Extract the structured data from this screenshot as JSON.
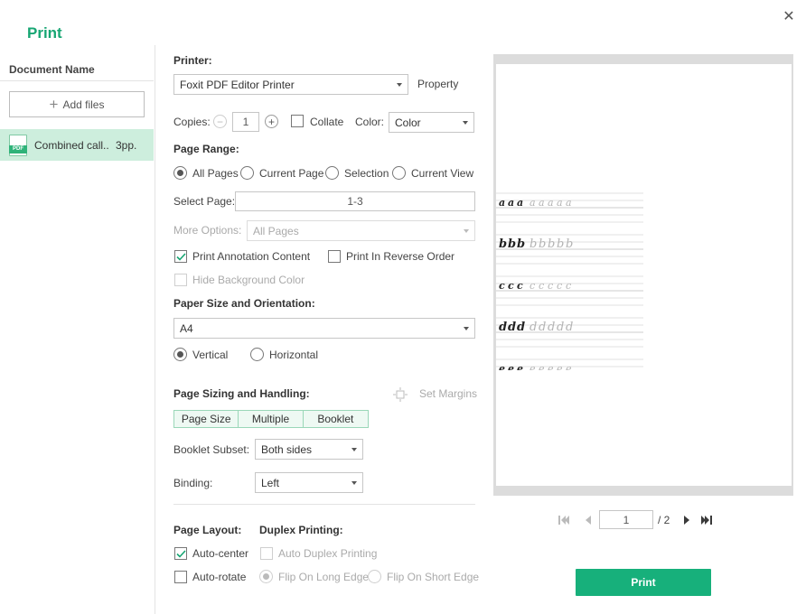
{
  "dialog": {
    "title": "Print"
  },
  "left": {
    "header": "Document Name",
    "add_files": "Add files",
    "documents": [
      {
        "name": "Combined call..",
        "pages": "3pp."
      }
    ]
  },
  "printer": {
    "label": "Printer:",
    "selected": "Foxit PDF Editor Printer",
    "property": "Property"
  },
  "copies": {
    "label": "Copies:",
    "value": "1",
    "collate_label": "Collate",
    "collate_checked": false
  },
  "color": {
    "label": "Color:",
    "selected": "Color"
  },
  "page_range": {
    "label": "Page Range:",
    "options": [
      "All Pages",
      "Current Page",
      "Selection",
      "Current View"
    ],
    "selected": "All Pages",
    "select_page_label": "Select Page:",
    "select_page_value": "1-3",
    "more_options_label": "More Options:",
    "more_options_value": "All Pages"
  },
  "options": {
    "print_annotation": {
      "label": "Print Annotation Content",
      "checked": true
    },
    "reverse_order": {
      "label": "Print In Reverse Order",
      "checked": false
    },
    "hide_background": {
      "label": "Hide Background Color",
      "checked": false
    }
  },
  "paper": {
    "label": "Paper Size and Orientation:",
    "size": "A4",
    "orientations": [
      "Vertical",
      "Horizontal"
    ],
    "orientation": "Vertical"
  },
  "sizing": {
    "label": "Page Sizing and Handling:",
    "set_margins": "Set Margins",
    "modes": [
      "Page Size",
      "Multiple",
      "Booklet"
    ],
    "booklet_subset_label": "Booklet Subset:",
    "booklet_subset": "Both sides",
    "binding_label": "Binding:",
    "binding": "Left"
  },
  "layout": {
    "label": "Page Layout:",
    "auto_center": {
      "label": "Auto-center",
      "checked": true
    },
    "auto_rotate": {
      "label": "Auto-rotate",
      "checked": false
    }
  },
  "duplex": {
    "label": "Duplex Printing:",
    "auto_duplex": {
      "label": "Auto Duplex Printing",
      "checked": false
    },
    "flip_long": "Flip On Long Edge",
    "flip_short": "Flip On Short Edge",
    "selected": "Flip On Long Edge"
  },
  "preview": {
    "rows": [
      "a",
      "b",
      "c",
      "d",
      "e"
    ],
    "current_page": "1",
    "total": "/ 2"
  },
  "actions": {
    "print": "Print"
  },
  "colors": {
    "accent": "#17b07b",
    "title": "#17a673",
    "selected_row": "#cdeedd"
  },
  "icons": [
    "close-icon",
    "plus-icon",
    "pdf-file-icon",
    "minus-icon",
    "plus-circle-icon",
    "check-icon",
    "margins-icon",
    "first-page-icon",
    "prev-page-icon",
    "next-page-icon",
    "last-page-icon"
  ]
}
